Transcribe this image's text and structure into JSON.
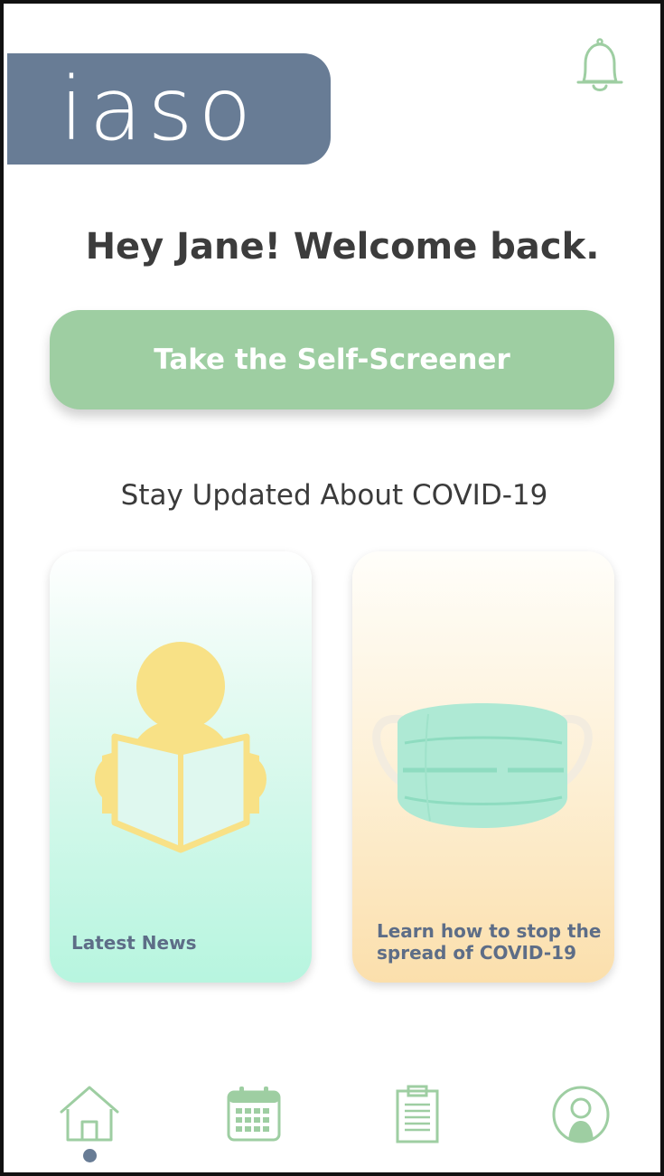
{
  "header": {
    "logo_text": "iaso",
    "bell_icon": "bell-icon"
  },
  "greeting": "Hey Jane! Welcome back.",
  "cta": {
    "label": "Take the Self-Screener"
  },
  "section": {
    "title": "Stay Updated About COVID-19"
  },
  "cards": [
    {
      "label": "Latest News",
      "icon": "person-reading-icon"
    },
    {
      "label": "Learn how to stop the spread of COVID-19",
      "icon": "face-mask-icon"
    }
  ],
  "nav": {
    "items": [
      {
        "icon": "home-icon",
        "active": true
      },
      {
        "icon": "calendar-icon",
        "active": false
      },
      {
        "icon": "clipboard-icon",
        "active": false
      },
      {
        "icon": "profile-icon",
        "active": false
      }
    ]
  },
  "colors": {
    "brand_slate": "#687c95",
    "accent_green": "#9ecea2",
    "text_dark": "#3c3c3c",
    "card_label": "#5d6d87"
  }
}
